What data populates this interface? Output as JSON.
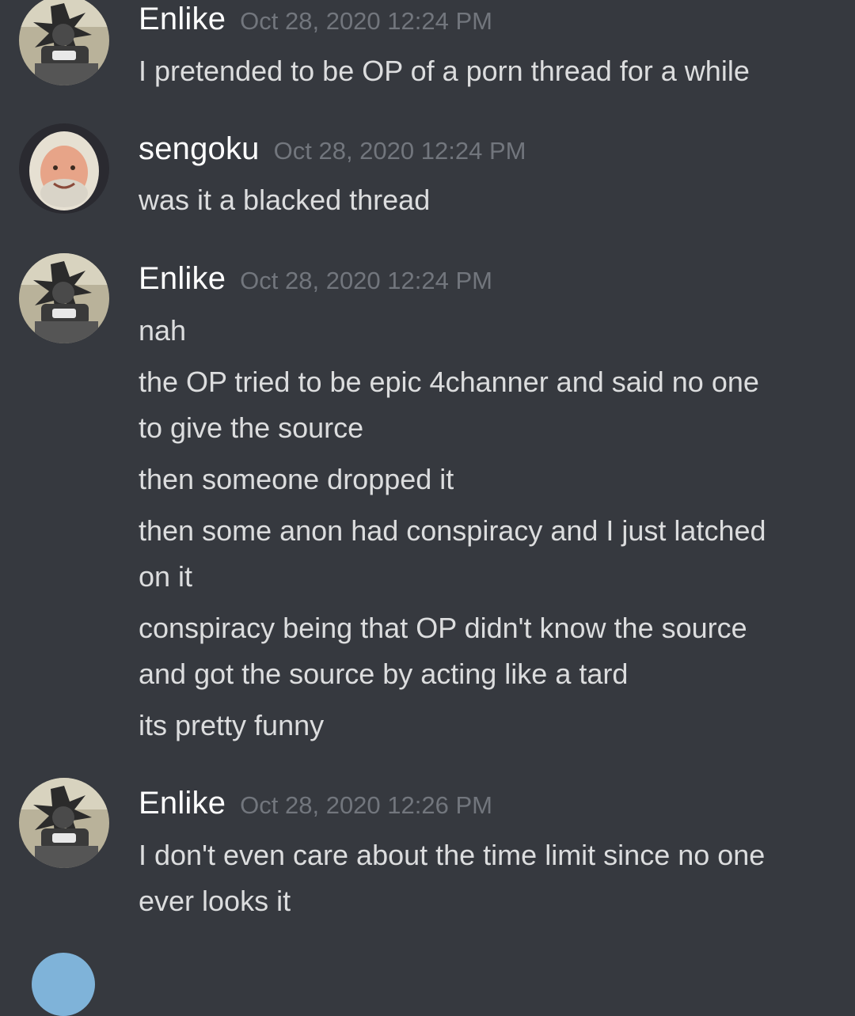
{
  "messages": [
    {
      "username": "Enlike",
      "timestamp": "Oct 28, 2020 12:24 PM",
      "avatar": "armored-figure-avatar",
      "lines": [
        "I pretended to be OP of a porn thread for a while"
      ]
    },
    {
      "username": "sengoku",
      "timestamp": "Oct 28, 2020 12:24 PM",
      "avatar": "smiling-man-avatar",
      "lines": [
        "was it a blacked thread"
      ]
    },
    {
      "username": "Enlike",
      "timestamp": "Oct 28, 2020 12:24 PM",
      "avatar": "armored-figure-avatar",
      "lines": [
        "nah",
        "the OP tried to be epic 4channer and said no one",
        "to give the source",
        "then someone dropped it",
        "then some anon had conspiracy and I just latched",
        "on it",
        "conspiracy being that OP didn't know the source",
        "and got the source by acting like a tard",
        "its pretty funny"
      ]
    },
    {
      "username": "Enlike",
      "timestamp": "Oct 28, 2020 12:26 PM",
      "avatar": "armored-figure-avatar",
      "lines": [
        "I don't even care about the time limit since no one",
        "ever looks it"
      ]
    }
  ],
  "colors": {
    "background": "#36393f",
    "username": "#ffffff",
    "timestamp": "#72767d",
    "text": "#dcddde"
  }
}
